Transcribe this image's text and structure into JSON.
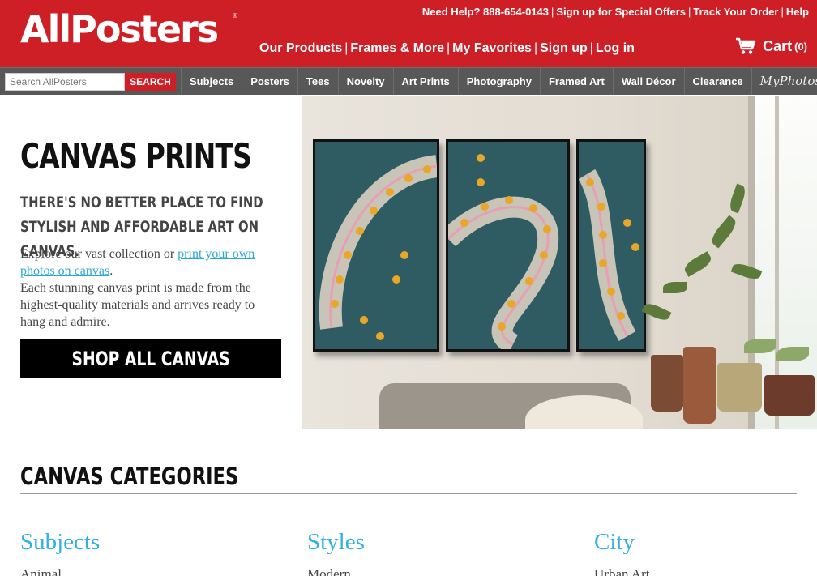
{
  "header": {
    "logo": "AllPosters",
    "trademark": "®",
    "util_links": [
      "Need Help? 888-654-0143",
      "Sign up for Special Offers",
      "Track Your Order",
      "Help"
    ],
    "main_links": [
      "Our Products",
      "Frames & More",
      "My Favorites",
      "Sign up",
      "Log in"
    ],
    "cart_label": "Cart",
    "cart_count": "(0)"
  },
  "nav": {
    "search_placeholder": "Search AllPosters",
    "search_button": "SEARCH",
    "items": [
      "Subjects",
      "Posters",
      "Tees",
      "Novelty",
      "Art Prints",
      "Photography",
      "Framed Art",
      "Wall Décor",
      "Clearance"
    ],
    "myphotos": "MyPhotos"
  },
  "hero": {
    "title": "CANVAS PRINTS",
    "subtitle": "THERE'S NO BETTER PLACE TO FIND STYLISH AND AFFORDABLE ART ON CANVAS.",
    "body_intro": "Explore our vast collection or ",
    "body_link": "print your own photos on canvas",
    "body_period": ".",
    "body_rest": "Each stunning canvas print is made from the highest-quality materials and arrives ready to hang and admire.",
    "cta": "SHOP ALL CANVAS"
  },
  "categories": {
    "title": "CANVAS CATEGORIES",
    "columns": [
      {
        "title": "Subjects",
        "first_item": "Animal"
      },
      {
        "title": "Styles",
        "first_item": "Modern"
      },
      {
        "title": "City",
        "first_item": "Urban Art"
      }
    ]
  },
  "colors": {
    "brand_red": "#cf1f26",
    "nav_gray": "#585858",
    "link_blue": "#29a8d8",
    "category_blue": "#33b0e0"
  },
  "icons": [
    "cart-icon"
  ]
}
